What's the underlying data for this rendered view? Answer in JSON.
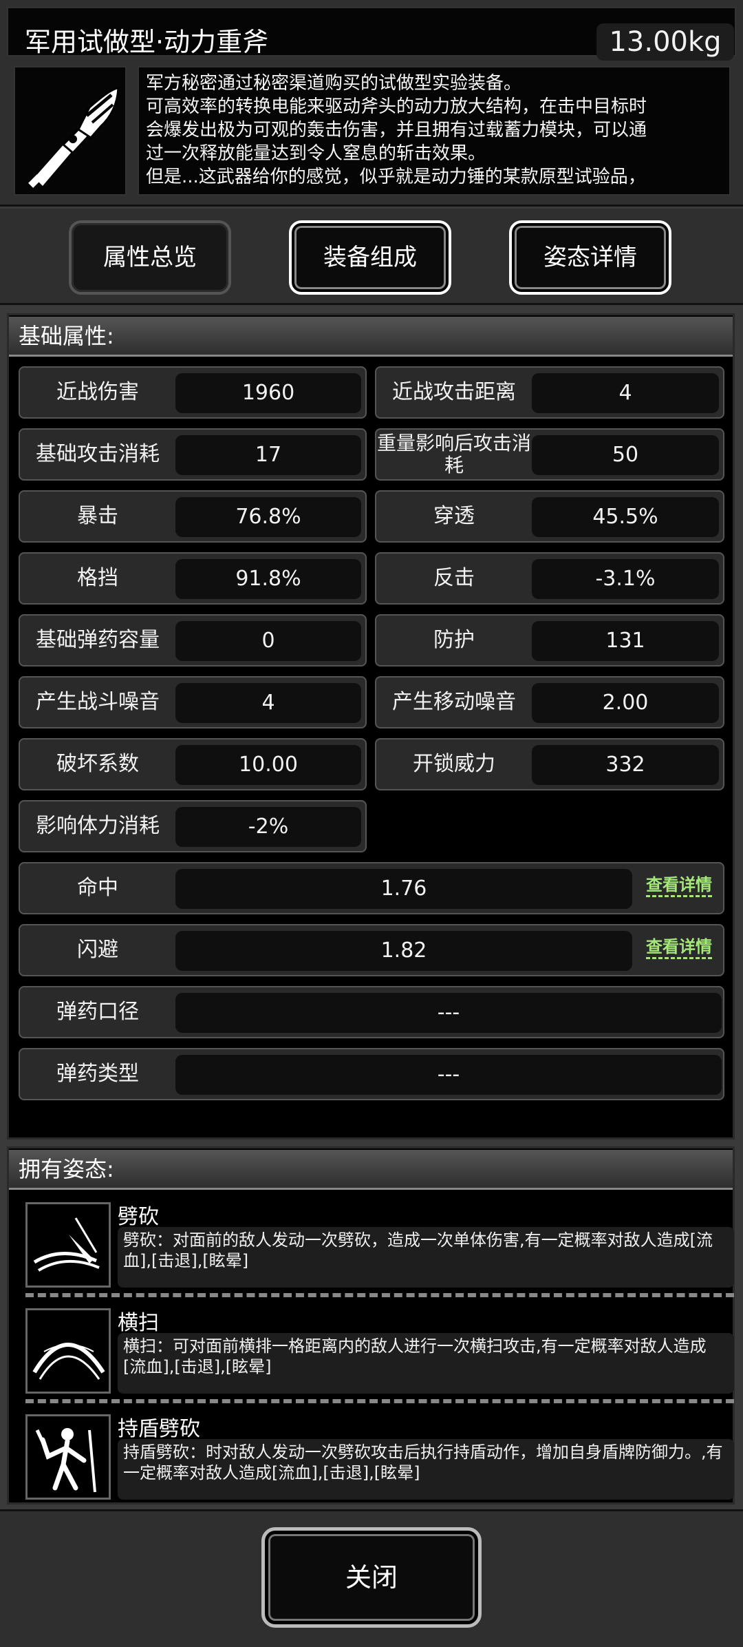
{
  "header": {
    "title": "军用试做型·动力重斧",
    "weight": "13.00kg",
    "description_lines": [
      "军方秘密通过秘密渠道购买的试做型实验装备。",
      "可高效率的转换电能来驱动斧头的动力放大结构，在击中目标时",
      "会爆发出极为可观的轰击伤害，并且拥有过载蓄力模块，可以通",
      "过一次释放能量达到令人窒息的斩击效果。",
      "但是...这武器给你的感觉，似乎就是动力锤的某款原型试验品，"
    ]
  },
  "tabs": [
    "属性总览",
    "装备组成",
    "姿态详情"
  ],
  "base_attrs": {
    "heading": "基础属性:",
    "pairs": [
      {
        "l1": "近战伤害",
        "v1": "1960",
        "l2": "近战攻击距离",
        "v2": "4"
      },
      {
        "l1": "基础攻击消耗",
        "v1": "17",
        "l2": "重量影响后攻击消耗",
        "v2": "50"
      },
      {
        "l1": "暴击",
        "v1": "76.8%",
        "l2": "穿透",
        "v2": "45.5%"
      },
      {
        "l1": "格挡",
        "v1": "91.8%",
        "l2": "反击",
        "v2": "-3.1%"
      },
      {
        "l1": "基础弹药容量",
        "v1": "0",
        "l2": "防护",
        "v2": "131"
      },
      {
        "l1": "产生战斗噪音",
        "v1": "4",
        "l2": "产生移动噪音",
        "v2": "2.00"
      },
      {
        "l1": "破坏系数",
        "v1": "10.00",
        "l2": "开锁威力",
        "v2": "332"
      }
    ],
    "single": {
      "l": "影响体力消耗",
      "v": "-2%"
    },
    "wide": [
      {
        "l": "命中",
        "v": "1.76",
        "link": "查看详情"
      },
      {
        "l": "闪避",
        "v": "1.82",
        "link": "查看详情"
      },
      {
        "l": "弹药口径",
        "v": "---"
      },
      {
        "l": "弹药类型",
        "v": "---"
      }
    ]
  },
  "stances": {
    "heading": "拥有姿态:",
    "items": [
      {
        "name": "劈砍",
        "desc": "劈砍：对面前的敌人发动一次劈砍，造成一次单体伤害,有一定概率对敌人造成[流血],[击退],[眩晕]",
        "icon": "slash-icon"
      },
      {
        "name": "横扫",
        "desc": "横扫：可对面前横排一格距离内的敌人进行一次横扫攻击,有一定概率对敌人造成[流血],[击退],[眩晕]",
        "icon": "sweep-icon"
      },
      {
        "name": "持盾劈砍",
        "desc": "持盾劈砍：时对敌人发动一次劈砍攻击后执行持盾动作，增加自身盾牌防御力。,有一定概率对敌人造成[流血],[击退],[眩晕]",
        "icon": "shield-slash-icon"
      }
    ]
  },
  "footer": {
    "close_label": "关闭"
  }
}
